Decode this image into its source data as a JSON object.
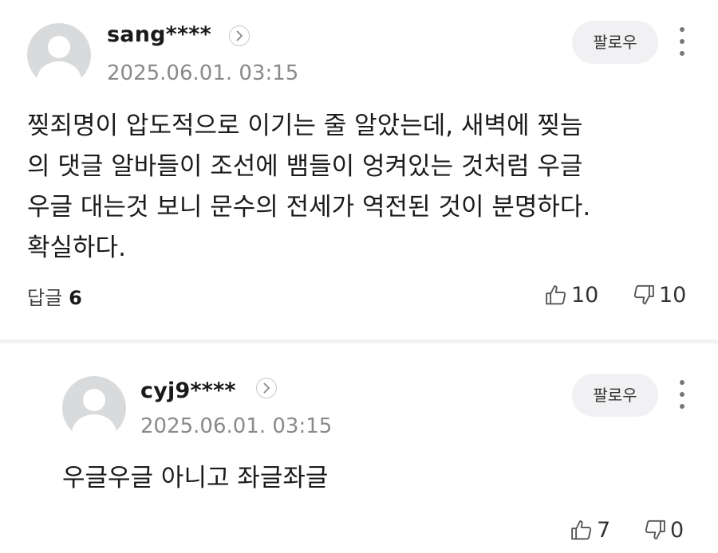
{
  "comments": [
    {
      "username": "sang****",
      "date": "2025.06.01. 03:15",
      "follow_label": "팔로우",
      "lines": [
        "찢죄명이 압도적으로 이기는 줄 알았는데, 새벽에 찢늠",
        "의 댓글 알바들이 조선에 뱀들이 엉켜있는 것처럼 우글",
        "우글 대는것 보니 문수의 전세가 역전된 것이 분명하다.",
        "확실하다."
      ],
      "reply_label": "답글",
      "reply_count": "6",
      "likes": "10",
      "dislikes": "10"
    },
    {
      "username": "cyj9****",
      "date": "2025.06.01. 03:15",
      "follow_label": "팔로우",
      "lines": [
        "우글우글 아니고 좌글좌글"
      ],
      "likes": "7",
      "dislikes": "0"
    }
  ]
}
